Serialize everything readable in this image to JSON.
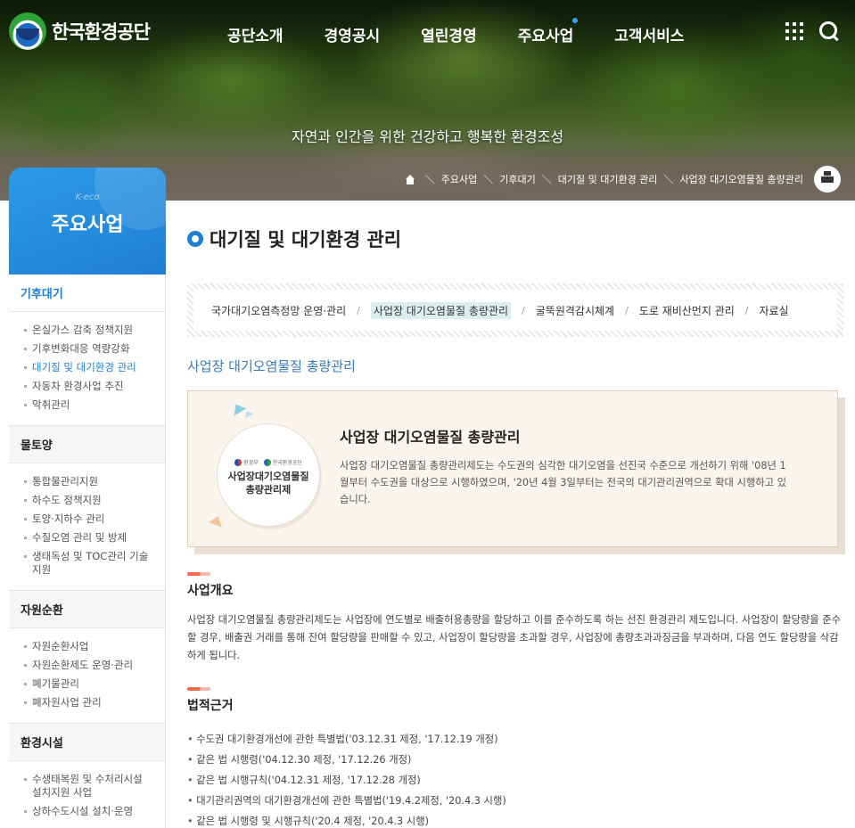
{
  "header": {
    "logo_text": "한국환경공단",
    "nav": [
      "공단소개",
      "경영공시",
      "열린경영",
      "주요사업",
      "고객서비스"
    ],
    "slogan": "자연과 인간을 위한 건강하고 행복한 환경조성"
  },
  "breadcrumb": [
    "주요사업",
    "기후대기",
    "대기질 및 대기환경 관리",
    "사업장 대기오염물질 총량관리"
  ],
  "sidebar": {
    "sub_label": "K-eco",
    "title": "주요사업",
    "groups": [
      {
        "title": "기후대기",
        "items": [
          "온실가스 감축 정책지원",
          "기후변화대응 역량강화",
          "대기질 및 대기환경 관리",
          "자동차 환경사업 추진",
          "악취관리"
        ]
      },
      {
        "title": "물토양",
        "items": [
          "통합물관리지원",
          "하수도 정책지원",
          "토양·지하수 관리",
          "수질오염 관리 및 방제",
          "생태독성 및 TOC관리 기술지원"
        ]
      },
      {
        "title": "자원순환",
        "items": [
          "자원순환사업",
          "자원순환제도 운영·관리",
          "폐기물관리",
          "폐자원사업 관리"
        ]
      },
      {
        "title": "환경시설",
        "items": [
          "수생태복원 및 수처리시설 설치지원 사업",
          "상하수도시설 설치·운영"
        ]
      }
    ]
  },
  "main": {
    "title": "대기질 및 대기환경 관리",
    "tabs": [
      "국가대기오염측정망 운영·관리",
      "사업장 대기오염물질 총량관리",
      "굴뚝원격감시체계",
      "도로 재비산먼지 관리",
      "자료실"
    ],
    "section_title": "사업장 대기오염물질 총량관리",
    "intro": {
      "badge_logo1": "환경부",
      "badge_logo2": "한국환경공단",
      "badge_line1": "사업장대기오염물질",
      "badge_line2": "총량관리제",
      "title": "사업장 대기오염물질 총량관리",
      "desc": "사업장 대기오염물질 총량관리제도는 수도권의 심각한 대기오염을 선진국 수준으로 개선하기 위해 '08년 1월부터 수도권을 대상으로 시행하였으며, '20년 4월 3일부터는 전국의 대기관리권역으로 확대 시행하고 있습니다."
    },
    "overview_title": "사업개요",
    "overview_text": "사업장 대기오염물질 총량관리제도는 사업장에 연도별로 배출허용총량을 할당하고 이를 준수하도록 하는 선진 환경관리 제도입니다. 사업장이 할당량을 준수할 경우, 배출권 거래를 통해 잔여 할당량을 판매할 수 있고, 사업장이 할당량을 초과할 경우, 사업장에 총량초과과징금을 부과하며, 다음 연도 할당량을 삭감하게 됩니다.",
    "law_title": "법적근거",
    "laws": [
      "수도권 대기환경개선에 관한 특별법('03.12.31 제정, '17.12.19 개정)",
      "같은 법 시행령('04.12.30 제정, '17.12.26 개정)",
      "같은 법 시행규칙('04.12.31 제정, '17.12.28 개정)",
      "대기관리권역의 대기환경개선에 관한 특별법('19.4.2제정, '20.4.3 시행)",
      "같은 법 시행령 및 시행규칙('20.4 제정, '20.4.3 시행)"
    ]
  }
}
